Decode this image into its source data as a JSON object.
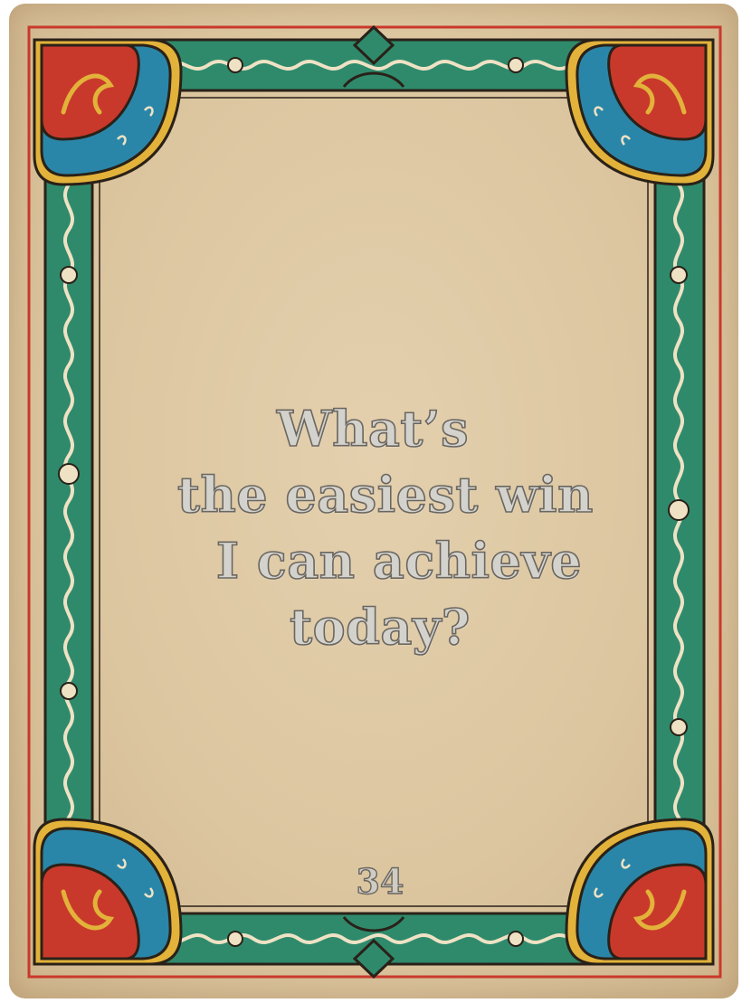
{
  "card": {
    "question_lines": [
      "What’s",
      "the easiest win",
      "I can achieve",
      "today?"
    ],
    "number": "34"
  },
  "colors": {
    "parchment": "#dcc6a0",
    "border_green": "#2f8a6c",
    "corner_red": "#c9392b",
    "corner_blue": "#2a86a8",
    "ornament_gold": "#e2b23a",
    "outline_dark": "#2a2118",
    "text_fill": "#d4d2cc",
    "text_outline": "#6a6660"
  }
}
